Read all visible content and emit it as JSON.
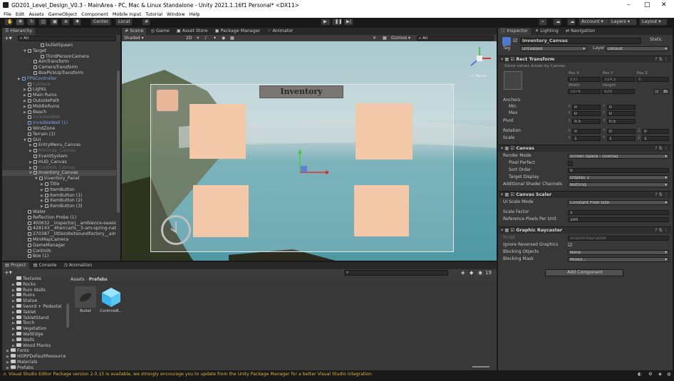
{
  "window": {
    "title": "GD201_Level_Design_V0.3 - MainArea - PC, Mac & Linux Standalone - Unity 2021.1.16f1 Personal* <DX11>",
    "minimize": "–",
    "maximize": "□",
    "close": "✕"
  },
  "menu": [
    "File",
    "Edit",
    "Assets",
    "GameObject",
    "Component",
    "Mobile Input",
    "Tutorial",
    "Window",
    "Help"
  ],
  "toolbar": {
    "pivot": "Center",
    "space": "Local",
    "account": "Account",
    "layers": "Layers",
    "layout": "Layout"
  },
  "hierarchy": {
    "tab": "Hierarchy",
    "search_placeholder": "All",
    "items": [
      {
        "label": "bulletSpawn",
        "indent": 48,
        "style": "normal",
        "arrow": ""
      },
      {
        "label": "Target",
        "indent": 30,
        "style": "normal",
        "arrow": "▼"
      },
      {
        "label": "ThirdPersonCamera",
        "indent": 48,
        "style": "normal",
        "arrow": ""
      },
      {
        "label": "AimTransform",
        "indent": 38,
        "style": "normal",
        "arrow": ""
      },
      {
        "label": "CameraTransform",
        "indent": 38,
        "style": "normal",
        "arrow": ""
      },
      {
        "label": "BoxPickUpTransform",
        "indent": 38,
        "style": "normal",
        "arrow": ""
      },
      {
        "label": "FPSController",
        "indent": 22,
        "style": "blue",
        "arrow": "▶"
      },
      {
        "label": "Camera",
        "indent": 30,
        "style": "dim",
        "arrow": ""
      },
      {
        "label": "Lights",
        "indent": 30,
        "style": "normal",
        "arrow": "▶"
      },
      {
        "label": "Main Ruins",
        "indent": 30,
        "style": "normal",
        "arrow": "▶"
      },
      {
        "label": "OutsidePath",
        "indent": 30,
        "style": "normal",
        "arrow": "▶"
      },
      {
        "label": "MiddleRuins",
        "indent": 30,
        "style": "normal",
        "arrow": "▶"
      },
      {
        "label": "Beach",
        "indent": 30,
        "style": "normal",
        "arrow": "▶"
      },
      {
        "label": "InvisibleWall",
        "indent": 30,
        "style": "dim",
        "arrow": ""
      },
      {
        "label": "InvisibleWall (1)",
        "indent": 30,
        "style": "blue",
        "arrow": ""
      },
      {
        "label": "WindZone",
        "indent": 30,
        "style": "normal",
        "arrow": ""
      },
      {
        "label": "Terrain (1)",
        "indent": 30,
        "style": "normal",
        "arrow": ""
      },
      {
        "label": "GUI",
        "indent": 30,
        "style": "normal",
        "arrow": "▼"
      },
      {
        "label": "EntryMenu_Canvas",
        "indent": 38,
        "style": "normal",
        "arrow": "▶"
      },
      {
        "label": "Minimap_Canvas",
        "indent": 38,
        "style": "dim",
        "arrow": "▶"
      },
      {
        "label": "EventSystem",
        "indent": 38,
        "style": "normal",
        "arrow": ""
      },
      {
        "label": "HUD_Canvas",
        "indent": 38,
        "style": "normal",
        "arrow": "▶"
      },
      {
        "label": "Controls_Canvas",
        "indent": 38,
        "style": "dim",
        "arrow": "▶"
      },
      {
        "label": "Inventory_Canvas",
        "indent": 38,
        "style": "selected",
        "arrow": "▼"
      },
      {
        "label": "Inventory_Panel",
        "indent": 46,
        "style": "normal",
        "arrow": "▼"
      },
      {
        "label": "Title",
        "indent": 54,
        "style": "normal",
        "arrow": "▶"
      },
      {
        "label": "ItemButton",
        "indent": 54,
        "style": "normal",
        "arrow": "▶"
      },
      {
        "label": "ItemButton (1)",
        "indent": 54,
        "style": "normal",
        "arrow": "▶"
      },
      {
        "label": "ItemButton (2)",
        "indent": 54,
        "style": "normal",
        "arrow": "▶"
      },
      {
        "label": "ItemButton (3)",
        "indent": 54,
        "style": "normal",
        "arrow": "▶"
      },
      {
        "label": "Water",
        "indent": 30,
        "style": "normal",
        "arrow": ""
      },
      {
        "label": "Reflection Probe (1)",
        "indent": 30,
        "style": "normal",
        "arrow": ""
      },
      {
        "label": "400632__inspectorj__ambience-seaside-wa",
        "indent": 30,
        "style": "normal",
        "arrow": ""
      },
      {
        "label": "428143__4herrcarls__5-am-spring-nature-",
        "indent": 30,
        "style": "normal",
        "arrow": ""
      },
      {
        "label": "270387__littlerobotsoundfactory__ambience-",
        "indent": 30,
        "style": "normal",
        "arrow": ""
      },
      {
        "label": "MiniMapCamera",
        "indent": 30,
        "style": "normal",
        "arrow": ""
      },
      {
        "label": "GameManager",
        "indent": 30,
        "style": "normal",
        "arrow": ""
      },
      {
        "label": "Controls",
        "indent": 30,
        "style": "normal",
        "arrow": ""
      },
      {
        "label": "Box (1)",
        "indent": 30,
        "style": "normal",
        "arrow": ""
      }
    ]
  },
  "scene": {
    "tabs": [
      "Scene",
      "Game",
      "Asset Store",
      "Package Manager",
      "Animator"
    ],
    "shading": "Shaded",
    "mode2d": "2D",
    "gizmos": "Gizmos",
    "search_placeholder": "All",
    "persp_label": "< Persp",
    "inventory_title": "Inventory"
  },
  "inspector": {
    "tabs": [
      "Inspector",
      "Lighting",
      "Navigation"
    ],
    "object_name": "Inventory_Canvas",
    "static_label": "Static",
    "tag_label": "Tag",
    "tag_value": "Untagged",
    "layer_label": "Layer",
    "layer_value": "Default",
    "rect_transform": {
      "title": "Rect Transform",
      "note": "Some values driven by Canvas.",
      "pos_x_label": "Pos X",
      "pos_y_label": "Pos Y",
      "pos_z_label": "Pos Z",
      "pos_x": "537",
      "pos_y": "314.5",
      "pos_z": "0",
      "width_label": "Width",
      "height_label": "Height",
      "width": "1074",
      "height": "629",
      "blueprint_btn": "",
      "raw_btn": "R",
      "anchors_label": "Anchors",
      "min_label": "Min",
      "max_label": "Max",
      "min_x": "0",
      "min_y": "0",
      "max_x": "0",
      "max_y": "0",
      "pivot_label": "Pivot",
      "pivot_x": "0.5",
      "pivot_y": "0.5",
      "rotation_label": "Rotation",
      "rot_x": "0",
      "rot_y": "0",
      "rot_z": "0",
      "scale_label": "Scale",
      "scale_x": "1",
      "scale_y": "1",
      "scale_z": "1",
      "axis_x": "X",
      "axis_y": "Y",
      "axis_z": "Z"
    },
    "canvas": {
      "title": "Canvas",
      "render_mode_label": "Render Mode",
      "render_mode": "Screen Space - Overlay",
      "pixel_perfect_label": "Pixel Perfect",
      "sort_order_label": "Sort Order",
      "sort_order": "0",
      "target_display_label": "Target Display",
      "target_display": "Display 1",
      "shader_channels_label": "Additional Shader Channels",
      "shader_channels": "Nothing"
    },
    "canvas_scaler": {
      "title": "Canvas Scaler",
      "ui_scale_label": "UI Scale Mode",
      "ui_scale": "Constant Pixel Size",
      "scale_factor_label": "Scale Factor",
      "scale_factor": "1",
      "ref_ppu_label": "Reference Pixels Per Unit",
      "ref_ppu": "100"
    },
    "graphic_raycaster": {
      "title": "Graphic Raycaster",
      "script_label": "Script",
      "script": "GraphicRaycaster",
      "ignore_reversed_label": "Ignore Reversed Graphics",
      "blocking_objects_label": "Blocking Objects",
      "blocking_objects": "None",
      "blocking_mask_label": "Blocking Mask",
      "blocking_mask": "Mixed..."
    },
    "add_component": "Add Component"
  },
  "project": {
    "tabs": [
      "Project",
      "Console",
      "Animation"
    ],
    "count_badge": "19",
    "folders": [
      "Textures",
      "Rocks",
      "Ruin Walls",
      "Ruins",
      "Statue",
      "Sword + Pedestal",
      "Tablet",
      "TabletStand",
      "Torch",
      "Vegetation",
      "WallEdge",
      "Walls",
      "Wood Planks",
      "Fonts",
      "HDRPDefaultResource",
      "Materials",
      "Prefabs"
    ],
    "breadcrumb": [
      "Assets",
      "Prefabs"
    ],
    "assets": [
      {
        "name": "Bullet"
      },
      {
        "name": "ControlsB..."
      }
    ]
  },
  "status": {
    "message": "Visual Studio Editor Package version 2.0.15 is available, we strongly encourage you to update from the Unity Package Manager for a better Visual Studio integration"
  },
  "colors": {
    "accent_blue": "#4d78cc",
    "panel_bg": "#383838",
    "slot": "#f2c8a8"
  }
}
